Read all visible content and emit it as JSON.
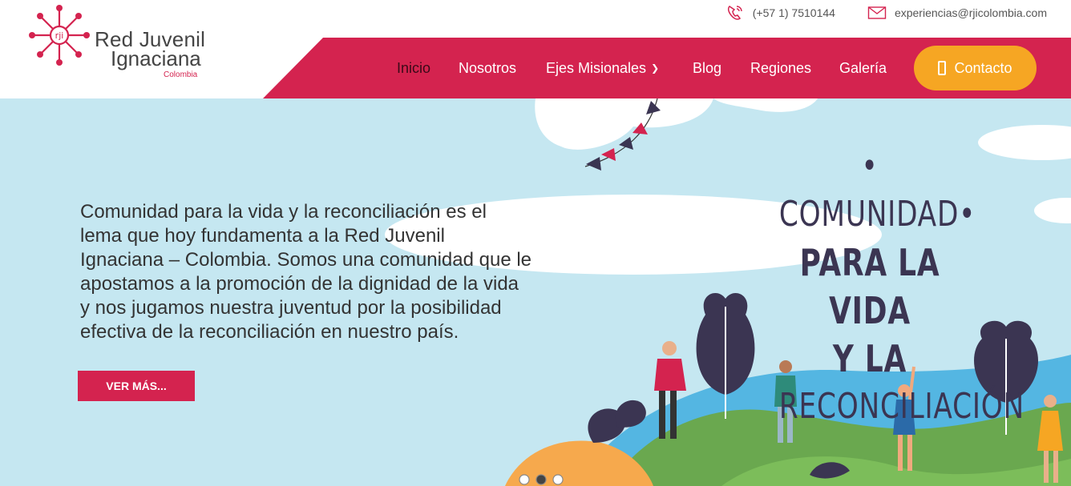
{
  "brand": {
    "name_line1": "Red Juvenil",
    "name_line2": "Ignaciana",
    "name_line3": "Colombia",
    "mark_text": "rji",
    "accent": "#d4234f"
  },
  "topbar": {
    "phone": "(+57 1) 7510144",
    "phone_icon": "phone-icon",
    "email": "experiencias@rjicolombia.com",
    "email_icon": "mail-icon"
  },
  "nav": {
    "items": [
      {
        "label": "Inicio",
        "active": true
      },
      {
        "label": "Nosotros"
      },
      {
        "label": "Ejes Misionales",
        "dropdown": true
      },
      {
        "label": "Blog"
      },
      {
        "label": "Regiones"
      },
      {
        "label": "Galería"
      }
    ],
    "contact_label": "Contacto",
    "contact_color": "#f6a623"
  },
  "hero": {
    "paragraph": "Comunidad para la vida y la reconciliación es el lema que hoy fundamenta a la Red Juvenil Ignaciana – Colombia. Somos una comunidad que le apostamos a la promoción de la dignidad de la vida y nos jugamos nuestra juventud por la posibilidad efectiva de la reconciliación en nuestro país.",
    "button_label": "VER MÁS...",
    "slogan_line1": "• COMUNIDAD•",
    "slogan_line2": "PARA LA VIDA",
    "slogan_line3": "Y LA",
    "slogan_line4": "RECONCILIACIÓN",
    "background": "#c5e7f1"
  }
}
